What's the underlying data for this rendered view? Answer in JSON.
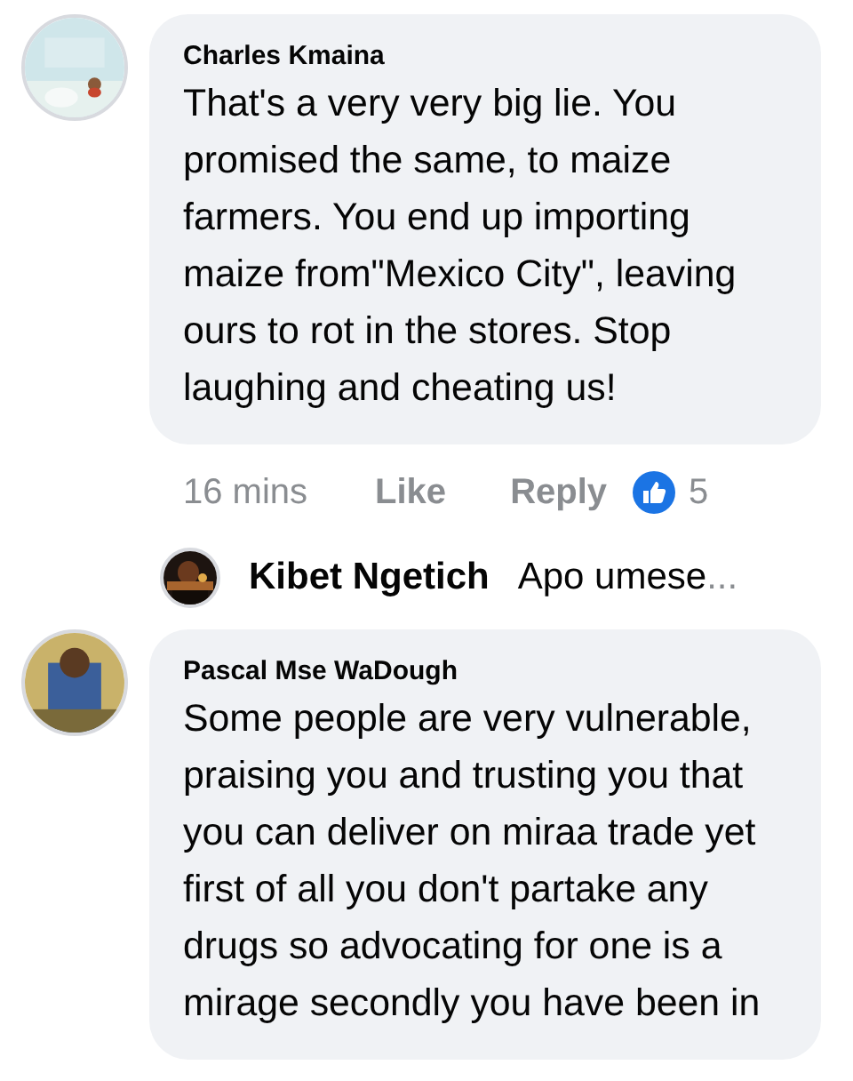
{
  "comments": [
    {
      "author": "Charles Kmaina",
      "text": "That's a very very big lie. You promised the same, to maize farmers. You end up importing maize from\"Mexico City\", leaving ours to rot in the stores. Stop laughing and cheating us!",
      "time": "16 mins",
      "actions": [
        "Like",
        "Reply"
      ],
      "reaction_count": "5",
      "replies": [
        {
          "author": "Kibet Ngetich",
          "text": "Apo umese",
          "more": "..."
        }
      ]
    },
    {
      "author": "Pascal Mse WaDough",
      "text": "Some people are very vulnerable, praising you and trusting you that you can deliver on miraa trade yet first of all you don't partake any drugs so advocating for one is a mirage secondly you have been in"
    }
  ]
}
